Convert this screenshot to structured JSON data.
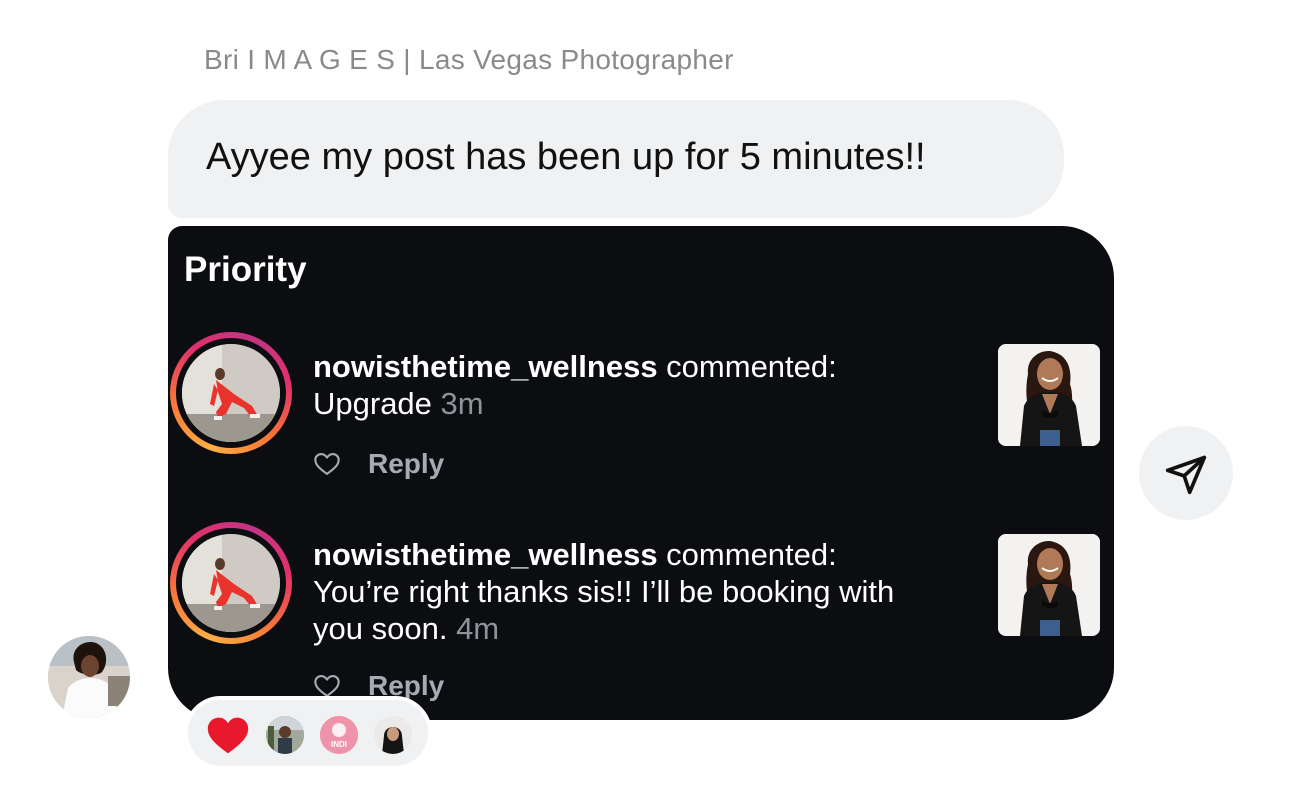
{
  "sender": {
    "name": "Bri I M A G E S | Las Vegas Photographer"
  },
  "message": {
    "text": "Ayyee my post has been up for 5 minutes!!"
  },
  "shared_card": {
    "title": "Priority",
    "notifications": [
      {
        "username": "nowisthetime_wellness",
        "action": " commented:",
        "comment": "Upgrade",
        "time": "3m",
        "reply_label": "Reply"
      },
      {
        "username": "nowisthetime_wellness",
        "action": " commented:",
        "comment": "You’re right thanks sis!! I’ll be booking with you soon.",
        "time": "4m",
        "reply_label": "Reply"
      }
    ]
  },
  "reactions": {
    "emoji": "❤️",
    "reactor_count": 3,
    "badge_text": "INDI"
  },
  "colors": {
    "card_bg": "#0b0d11",
    "bubble_bg": "#f0f1f3",
    "muted_text": "#8a8a8e",
    "time_text": "#8e9399",
    "reply_text": "#a7abb1",
    "story_ring_start": "#fcaf45",
    "story_ring_end": "#c13584",
    "heart_red": "#e8192c"
  },
  "icons": {
    "share": "paper-plane-icon",
    "like": "heart-outline-icon"
  }
}
